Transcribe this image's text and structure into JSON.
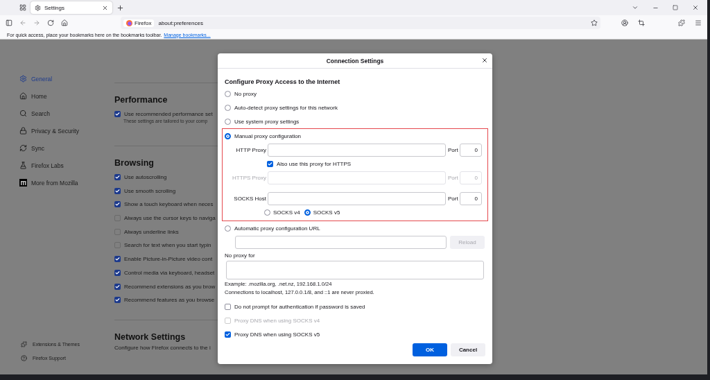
{
  "browser": {
    "tabs": [
      {
        "label": "Settings",
        "selected": true
      }
    ],
    "address": {
      "chip": "Firefox",
      "url": "about:preferences"
    },
    "bookmarks_bar": {
      "text": "For quick access, place your bookmarks here on the bookmarks toolbar.",
      "link": "Manage bookmarks..."
    }
  },
  "sidebar": {
    "items": [
      {
        "label": "General",
        "selected": true
      },
      {
        "label": "Home",
        "selected": false
      },
      {
        "label": "Search",
        "selected": false
      },
      {
        "label": "Privacy & Security",
        "selected": false
      },
      {
        "label": "Sync",
        "selected": false
      },
      {
        "label": "Firefox Labs",
        "selected": false
      },
      {
        "label": "More from Mozilla",
        "selected": false
      }
    ],
    "footer_items": [
      {
        "label": "Extensions & Themes"
      },
      {
        "label": "Firefox Support"
      }
    ]
  },
  "sections": [
    {
      "heading": "Performance",
      "options": [
        {
          "label": "Use recommended performance set",
          "checked": true,
          "description": "These settings are tailored to your comp"
        }
      ]
    },
    {
      "heading": "Browsing",
      "options": [
        {
          "label": "Use autoscrolling",
          "checked": true
        },
        {
          "label": "Use smooth scrolling",
          "checked": true
        },
        {
          "label": "Show a touch keyboard when neces",
          "checked": true
        },
        {
          "label": "Always use the cursor keys to naviga",
          "checked": false
        },
        {
          "label": "Always underline links",
          "checked": false
        },
        {
          "label": "Search for text when you start typin",
          "checked": false
        },
        {
          "label": "Enable Picture-in-Picture video cont",
          "checked": true
        },
        {
          "label": "Control media via keyboard, headset",
          "checked": true
        },
        {
          "label": "Recommend extensions as you brow",
          "checked": true
        },
        {
          "label": "Recommend features as you browse",
          "checked": true
        }
      ]
    },
    {
      "heading": "Network Settings",
      "description": "Configure how Firefox connects to the i"
    }
  ],
  "dialog": {
    "title": "Connection Settings",
    "heading": "Configure Proxy Access to the Internet",
    "modes": [
      {
        "kind": "plain",
        "label": "No proxy",
        "selected": false
      },
      {
        "kind": "plain",
        "label": "Auto-detect proxy settings for this network",
        "selected": false
      },
      {
        "kind": "plain",
        "label": "Use system proxy settings",
        "selected": false
      },
      {
        "kind": "manual",
        "label": "Manual proxy configuration",
        "selected": true,
        "rows": [
          {
            "kind": "host",
            "label": "HTTP Proxy",
            "port_label": "Port",
            "port": "0",
            "disabled": false
          },
          {
            "kind": "check",
            "label": "Also use this proxy for HTTPS",
            "checked": true
          },
          {
            "kind": "host",
            "label": "HTTPS Proxy",
            "port_label": "Port",
            "port": "0",
            "disabled": true
          },
          {
            "kind": "host",
            "label": "SOCKS Host",
            "port_label": "Port",
            "port": "0",
            "disabled": false
          },
          {
            "kind": "versions",
            "options": [
              {
                "label": "SOCKS v4",
                "selected": false
              },
              {
                "label": "SOCKS v5",
                "selected": true
              }
            ]
          }
        ]
      },
      {
        "kind": "auto_url",
        "label": "Automatic proxy configuration URL",
        "selected": false,
        "reload": {
          "label": "Reload",
          "disabled": true
        }
      }
    ],
    "no_proxy": {
      "label": "No proxy for"
    },
    "example": "Example: .mozilla.org, .net.nz, 192.168.1.0/24",
    "note": "Connections to localhost, 127.0.0.1/8, and ::1 are never proxied.",
    "checks": [
      {
        "label": "Do not prompt for authentication if password is saved",
        "checked": false,
        "disabled": false
      },
      {
        "label": "Proxy DNS when using SOCKS v4",
        "checked": false,
        "disabled": true
      },
      {
        "label": "Proxy DNS when using SOCKS v5",
        "checked": true,
        "disabled": false
      }
    ],
    "buttons": [
      {
        "label": "OK",
        "kind": "primary"
      },
      {
        "label": "Cancel",
        "kind": "secondary"
      }
    ]
  }
}
